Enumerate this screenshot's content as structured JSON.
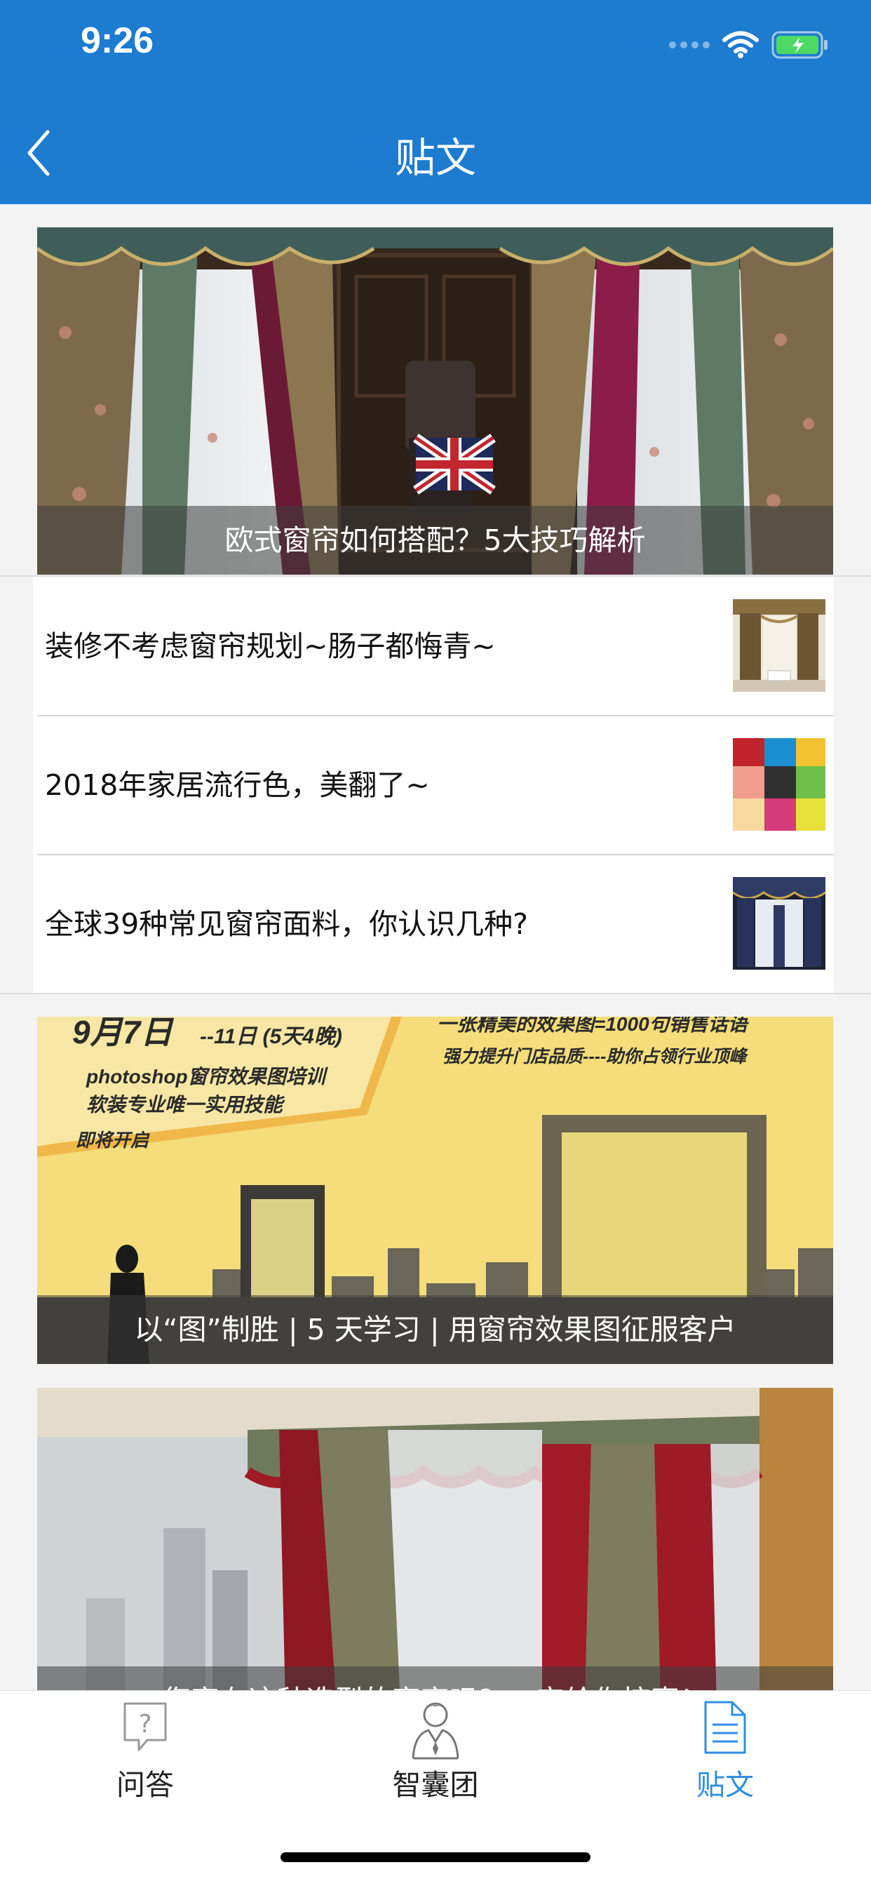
{
  "status_bar": {
    "time": "9:26"
  },
  "nav": {
    "title": "贴文"
  },
  "banners": [
    {
      "caption": "欧式窗帘如何搭配？5大技巧解析"
    },
    {
      "caption": "以“图”制胜 | 5 天学习 | 用窗帘效果图征服客户",
      "poster_text": {
        "date": "9月7日",
        "date_range": "--11日 (5天4晚)",
        "line1": "photoshop窗帘效果图培训",
        "line2": "软装专业唯一实用技能",
        "line3": "即将开启",
        "slogan": "一张精美的效果图=1000句销售话语",
        "slogan2": "强力提升门店品质----助你占领行业顶峰"
      }
    },
    {
      "caption": "您家有这种造型的窗帘吗？一定给你惊喜！"
    }
  ],
  "articles": [
    {
      "title": "装修不考虑窗帘规划~肠子都悔青~"
    },
    {
      "title": "2018年家居流行色，美翻了~"
    },
    {
      "title": "全球39种常见窗帘面料，你认识几种?"
    }
  ],
  "tabbar": {
    "tabs": [
      {
        "label": "问答",
        "icon": "question-icon",
        "active": false
      },
      {
        "label": "智囊团",
        "icon": "advisor-icon",
        "active": false
      },
      {
        "label": "贴文",
        "icon": "document-icon",
        "active": true
      }
    ]
  },
  "colors": {
    "header": "#1d7bd0",
    "active_tab": "#2f8de4"
  }
}
